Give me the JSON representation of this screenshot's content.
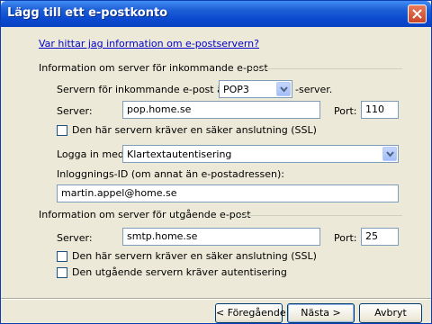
{
  "window": {
    "title": "Lägg till ett e-postkonto"
  },
  "help_link": "Var hittar jag information om e-postservern?",
  "incoming": {
    "group_label": "Information om server för inkommande e-post",
    "type_prefix": "Servern för inkommande e-post är en",
    "type_value": "POP3",
    "type_suffix": "-server.",
    "server_label": "Server:",
    "server_value": "pop.home.se",
    "port_label": "Port:",
    "port_value": "110",
    "ssl_label": "Den här servern kräver en säker anslutning (SSL)",
    "ssl_checked": false,
    "login_label": "Logga in med:",
    "login_value": "Klartextautentisering",
    "login_id_label": "Inloggnings-ID (om annat än e-postadressen):",
    "login_id_value": "martin.appel@home.se"
  },
  "outgoing": {
    "group_label": "Information om server för utgående e-post",
    "server_label": "Server:",
    "server_value": "smtp.home.se",
    "port_label": "Port:",
    "port_value": "25",
    "ssl_label": "Den här servern kräver en säker anslutning (SSL)",
    "ssl_checked": false,
    "auth_label": "Den utgående servern kräver autentisering",
    "auth_checked": false
  },
  "buttons": {
    "back": "< Föregående",
    "next": "Nästa >",
    "cancel": "Avbryt"
  },
  "colors": {
    "titlebar": "#0a49cf",
    "link": "#0000cc",
    "dialog_bg": "#ece9d8"
  }
}
